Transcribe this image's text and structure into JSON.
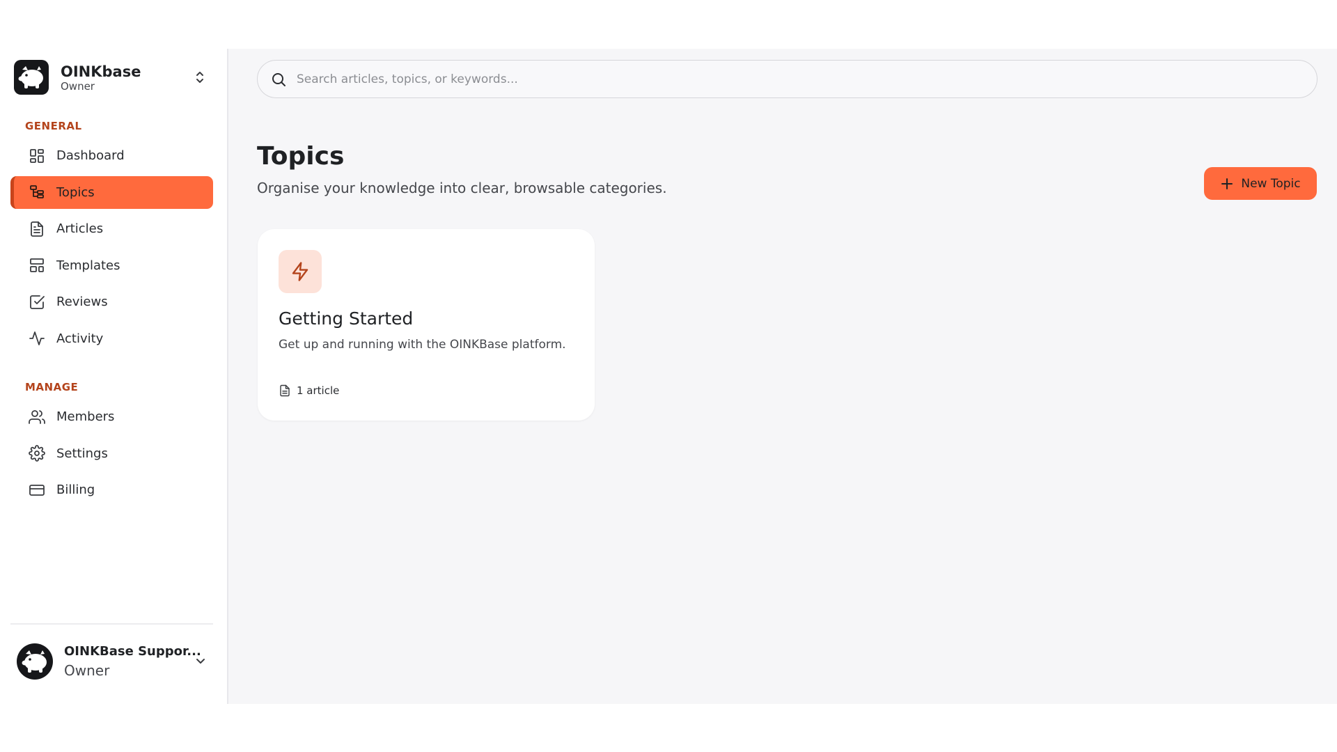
{
  "workspace": {
    "name": "OINKbase",
    "role": "Owner"
  },
  "sidebar": {
    "general_label": "GENERAL",
    "manage_label": "MANAGE",
    "general_items": [
      {
        "label": "Dashboard",
        "icon": "dashboard-icon"
      },
      {
        "label": "Topics",
        "icon": "topics-icon",
        "active": true
      },
      {
        "label": "Articles",
        "icon": "article-icon"
      },
      {
        "label": "Templates",
        "icon": "templates-icon"
      },
      {
        "label": "Reviews",
        "icon": "check-square-icon"
      },
      {
        "label": "Activity",
        "icon": "activity-icon"
      }
    ],
    "manage_items": [
      {
        "label": "Members",
        "icon": "users-icon"
      },
      {
        "label": "Settings",
        "icon": "gear-icon"
      },
      {
        "label": "Billing",
        "icon": "credit-card-icon"
      }
    ]
  },
  "user": {
    "name": "OINKBase Suppor...",
    "role": "Owner"
  },
  "search": {
    "placeholder": "Search articles, topics, or keywords...",
    "value": ""
  },
  "page": {
    "title": "Topics",
    "subtitle": "Organise your knowledge into clear, browsable categories."
  },
  "actions": {
    "new_topic_label": "New Topic"
  },
  "topics": [
    {
      "name": "Getting Started",
      "description": "Get up and running with the OINKBase platform.",
      "article_count": "1 article",
      "icon": "lightning-icon"
    }
  ],
  "colors": {
    "accent": "#ff6a3d",
    "accent_dark": "#c8441b",
    "section_label": "#b4441c",
    "icon_tile": "#fde2d9",
    "page_bg": "#f6f6f8"
  }
}
